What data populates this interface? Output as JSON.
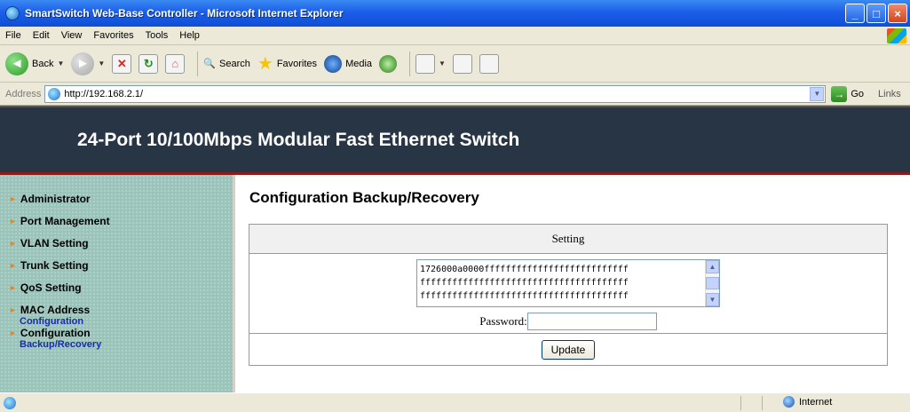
{
  "window": {
    "title": "SmartSwitch Web-Base Controller - Microsoft Internet Explorer",
    "minimize": "_",
    "maximize": "□",
    "close": "×"
  },
  "menu": [
    "File",
    "Edit",
    "View",
    "Favorites",
    "Tools",
    "Help"
  ],
  "toolbar": {
    "back": "Back",
    "search": "Search",
    "favorites": "Favorites",
    "media": "Media"
  },
  "address": {
    "label": "Address",
    "url": "http://192.168.2.1/",
    "go": "Go",
    "links": "Links"
  },
  "banner": {
    "title": "24-Port 10/100Mbps Modular Fast Ethernet Switch"
  },
  "sidebar": {
    "items": [
      {
        "label": "Administrator"
      },
      {
        "label": "Port Management"
      },
      {
        "label": "VLAN Setting"
      },
      {
        "label": "Trunk Setting"
      },
      {
        "label": "QoS Setting"
      },
      {
        "label": "MAC Address",
        "sub": "Configuration"
      },
      {
        "label": "Configuration",
        "sub": "Backup/Recovery"
      }
    ]
  },
  "main": {
    "title": "Configuration Backup/Recovery",
    "table_header": "Setting",
    "config_lines": [
      "1726000a0000fffffffffffffffffffffffffff",
      "fffffffffffffffffffffffffffffffffffffff",
      "fffffffffffffffffffffffffffffffffffffff"
    ],
    "password_label": "Password:",
    "password_value": "",
    "update_button": "Update"
  },
  "statusbar": {
    "zone": "Internet"
  },
  "colors": {
    "banner_bg": "#283545",
    "banner_border": "#8b1c1c",
    "sidebar_bg": "#9ac3ba",
    "sub_link": "#1b2ca8",
    "nav_arrow": "#d98a32"
  },
  "icons": {
    "nav_arrow": "►",
    "back": "◄",
    "forward": "►",
    "stop": "✕",
    "refresh": "↻",
    "home": "⌂",
    "search": "🔍",
    "favorites": "★",
    "dropdown": "▼",
    "scroll_up": "▲",
    "scroll_down": "▼",
    "go": "→"
  }
}
